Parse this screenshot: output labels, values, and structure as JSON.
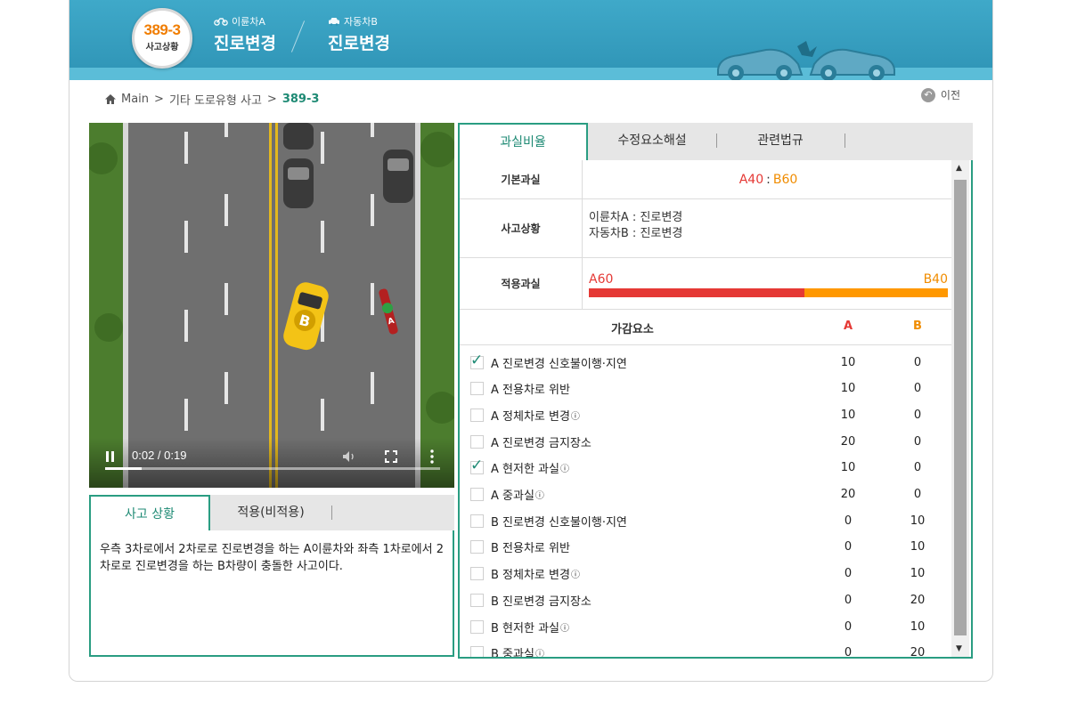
{
  "header": {
    "badge_number": "389-3",
    "badge_label": "사고상황",
    "vehicle_a_label": "이륜차A",
    "vehicle_a_action": "진로변경",
    "vehicle_b_label": "자동차B",
    "vehicle_b_action": "진로변경"
  },
  "breadcrumb": {
    "home": "Main",
    "category": "기타 도로유형 사고",
    "current": "389-3",
    "separator": ">"
  },
  "back_button": {
    "label": "이전"
  },
  "video": {
    "time": "0:02 / 0:19",
    "progress": 0.11
  },
  "left_tabs": {
    "tab1": "사고 상황",
    "tab2": "적용(비적용)"
  },
  "accident_description": "우측 3차로에서 2차로로 진로변경을 하는 A이륜차와 좌측 1차로에서 2차로로 진로변경을 하는 B차량이 충돌한 사고이다.",
  "right_tabs": {
    "tab1": "과실비율",
    "tab2": "수정요소해설",
    "tab3": "관련법규"
  },
  "fault": {
    "base_label": "기본과실",
    "base_a": "A40",
    "base_sep": ":",
    "base_b": "B60",
    "situation_label": "사고상황",
    "situation_a": "이륜차A : 진로변경",
    "situation_b": "자동차B : 진로변경",
    "applied_label": "적용과실",
    "applied_a": "A60",
    "applied_b": "B40",
    "applied_a_fraction": 0.6
  },
  "factors": {
    "header": "가감요소",
    "col_a": "A",
    "col_b": "B",
    "items": [
      {
        "label": "A 진로변경 신호불이행·지연",
        "a": "10",
        "b": "0",
        "checked": true
      },
      {
        "label": "A 전용차로 위반",
        "a": "10",
        "b": "0",
        "checked": false
      },
      {
        "label": "A 정체차로 변경",
        "a": "10",
        "b": "0",
        "checked": false,
        "info": "ⓘ"
      },
      {
        "label": "A 진로변경 금지장소",
        "a": "20",
        "b": "0",
        "checked": false
      },
      {
        "label": "A 현저한 과실",
        "a": "10",
        "b": "0",
        "checked": true,
        "info": "ⓘ"
      },
      {
        "label": "A 중과실",
        "a": "20",
        "b": "0",
        "checked": false,
        "info": "ⓘ"
      },
      {
        "label": "B 진로변경 신호불이행·지연",
        "a": "0",
        "b": "10",
        "checked": false
      },
      {
        "label": "B 전용차로 위반",
        "a": "0",
        "b": "10",
        "checked": false
      },
      {
        "label": "B 정체차로 변경",
        "a": "0",
        "b": "10",
        "checked": false,
        "info": "ⓘ"
      },
      {
        "label": "B 진로변경 금지장소",
        "a": "0",
        "b": "20",
        "checked": false
      },
      {
        "label": "B 현저한 과실",
        "a": "0",
        "b": "10",
        "checked": false,
        "info": "ⓘ"
      },
      {
        "label": "B 중과실",
        "a": "0",
        "b": "20",
        "checked": false,
        "info": "ⓘ"
      }
    ]
  },
  "colors": {
    "accent": "#2a9d82",
    "fault_a": "#e53935",
    "fault_b": "#ff9800",
    "banner": "#2e93b5"
  }
}
